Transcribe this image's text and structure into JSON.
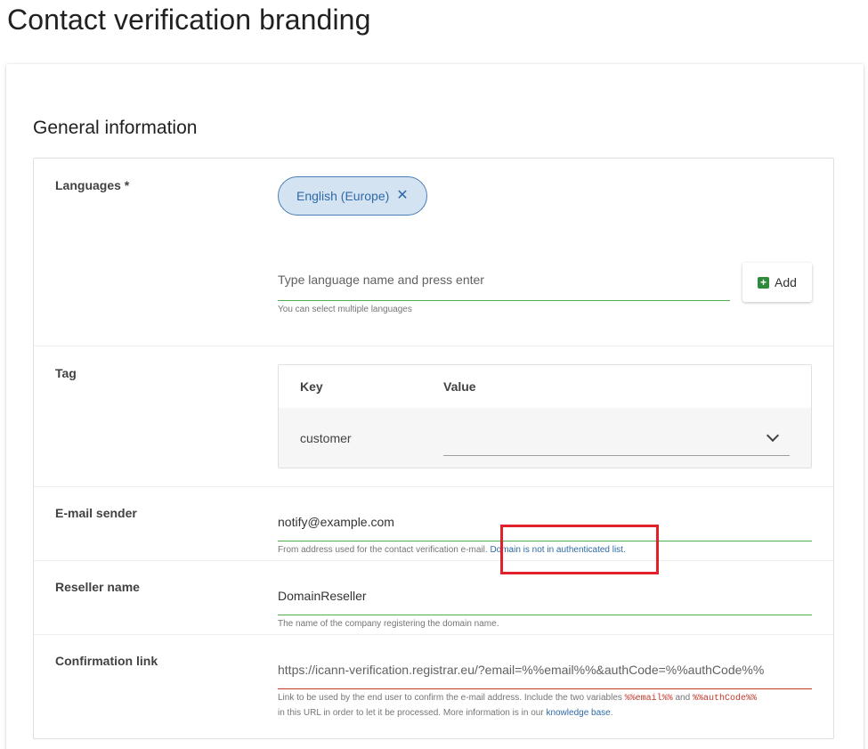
{
  "page": {
    "title": "Contact verification branding"
  },
  "section": {
    "title": "General information"
  },
  "languages": {
    "label": "Languages *",
    "chip": "English (Europe)",
    "input_placeholder": "Type language name and press enter",
    "hint": "You can select multiple languages",
    "add_label": "Add"
  },
  "tag": {
    "label": "Tag",
    "header_key": "Key",
    "header_value": "Value",
    "row_key": "customer"
  },
  "email_sender": {
    "label": "E-mail sender",
    "value": "notify@example.com",
    "hint": "From address used for the contact verification e-mail.",
    "warning": "Domain is not in authenticated list."
  },
  "reseller": {
    "label": "Reseller name",
    "value": "DomainReseller",
    "hint": "The name of the company registering the domain name."
  },
  "confirmation": {
    "label": "Confirmation link",
    "value": "https://icann-verification.registrar.eu/?email=%%email%%&authCode=%%authCode%%",
    "hint_part1": "Link to be used by the end user to confirm the e-mail address. Include the two variables",
    "var_email": "%%email%%",
    "hint_and": "and",
    "var_auth": "%%authCode%%",
    "hint_part2": "in this URL in order to let it be processed. More information is in our",
    "kb_link": "knowledge base",
    "hint_end": "."
  },
  "colors": {
    "accent_green": "#4caf50",
    "error_red": "#c0392b",
    "link_blue": "#2f6aa6",
    "highlight_red": "#e0202a"
  }
}
